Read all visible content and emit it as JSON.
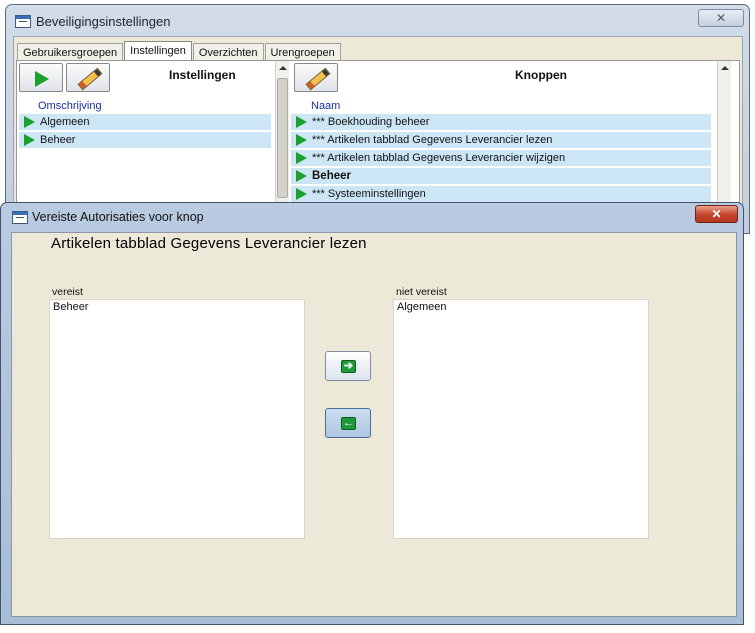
{
  "back_window": {
    "title": "Beveiligingsinstellingen",
    "close_label": "✕",
    "tabs": [
      {
        "label": "Gebruikersgroepen",
        "active": false
      },
      {
        "label": "Instellingen",
        "active": true
      },
      {
        "label": "Overzichten",
        "active": false
      },
      {
        "label": "Urengroepen",
        "active": false
      }
    ],
    "left_panel": {
      "header": "Instellingen",
      "column_header": "Omschrijving",
      "rows": [
        "Algemeen",
        "Beheer"
      ]
    },
    "right_panel": {
      "header": "Knoppen",
      "column_header": "Naam",
      "rows": [
        {
          "label": "*** Boekhouding beheer",
          "bold": false
        },
        {
          "label": "*** Artikelen tabblad Gegevens Leverancier lezen",
          "bold": false
        },
        {
          "label": "*** Artikelen tabblad Gegevens Leverancier wijzigen",
          "bold": false
        },
        {
          "label": "Beheer",
          "bold": true
        },
        {
          "label": "*** Systeeminstellingen",
          "bold": false
        }
      ]
    }
  },
  "dialog": {
    "title": "Vereiste Autorisaties voor knop",
    "close_label": "✕",
    "heading": "Artikelen tabblad Gegevens Leverancier lezen",
    "required": {
      "label": "vereist",
      "items": [
        "Beheer"
      ]
    },
    "not_required": {
      "label": "niet vereist",
      "items": [
        "Algemeen"
      ]
    },
    "move_right_glyph": "➔",
    "move_left_glyph": "←"
  },
  "colors": {
    "row_highlight": "#cde6f6",
    "play_green": "#1aa12b",
    "column_header_blue": "#1c2f9c",
    "close_red": "#c4432b"
  }
}
